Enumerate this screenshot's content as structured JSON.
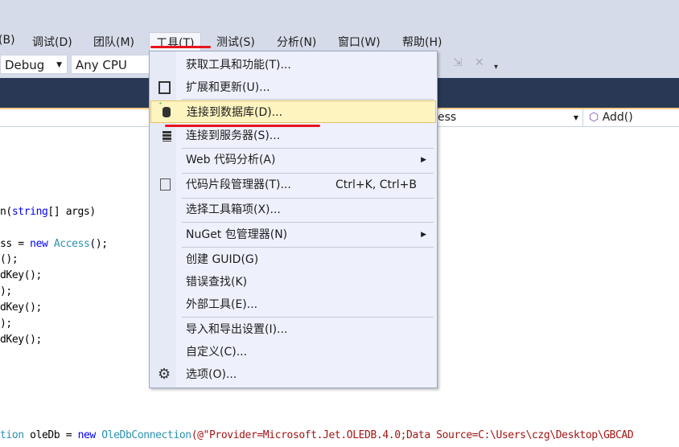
{
  "menubar": {
    "items": [
      "(B)",
      "调试(D)",
      "团队(M)",
      "工具(T)",
      "测试(S)",
      "分析(N)",
      "窗口(W)",
      "帮助(H)"
    ]
  },
  "toolbar": {
    "config": "Debug",
    "platform": "Any CPU"
  },
  "navbar": {
    "member_combo": "ess",
    "method": "Add()"
  },
  "code": {
    "l1a": "n(",
    "l1b": "string",
    "l1c": "[] args)",
    "l2a": "ss = ",
    "l2b": "new",
    "l2c": " ",
    "l2d": "Access",
    "l2e": "();",
    "l3": "();",
    "l4": "dKey();",
    "l5": ");",
    "l6": "dKey();",
    "l7": ");",
    "l8": "dKey();",
    "l9a": "tion",
    "l9b": " oleDb = ",
    "l9c": "new",
    "l9d": " ",
    "l9e": "OleDbConnection",
    "l9f": "(@\"Provider=Microsoft.Jet.OLEDB.4.0;Data Source=C:\\Users\\czg\\Desktop\\GBCAD"
  },
  "tools_menu": {
    "items": [
      {
        "label": "获取工具和功能(T)...",
        "icon": "none"
      },
      {
        "label": "扩展和更新(U)...",
        "icon": "extensions-icon"
      },
      {
        "label": "连接到数据库(D)...",
        "icon": "database-connect-icon",
        "highlighted": true
      },
      {
        "label": "连接到服务器(S)...",
        "icon": "server-connect-icon"
      },
      {
        "label": "Web 代码分析(A)",
        "submenu": true
      },
      {
        "label": "代码片段管理器(T)...",
        "shortcut": "Ctrl+K, Ctrl+B",
        "icon": "snippet-icon"
      },
      {
        "label": "选择工具箱项(X)..."
      },
      {
        "label": "NuGet 包管理器(N)",
        "submenu": true
      },
      {
        "label": "创建 GUID(G)"
      },
      {
        "label": "错误查找(K)"
      },
      {
        "label": "外部工具(E)..."
      },
      {
        "label": "导入和导出设置(I)..."
      },
      {
        "label": "自定义(C)..."
      },
      {
        "label": "选项(O)...",
        "icon": "gear-icon"
      }
    ]
  },
  "colors": {
    "highlight": "#fdf4bf",
    "annotation": "#e8141e",
    "dark_band": "#293955"
  }
}
